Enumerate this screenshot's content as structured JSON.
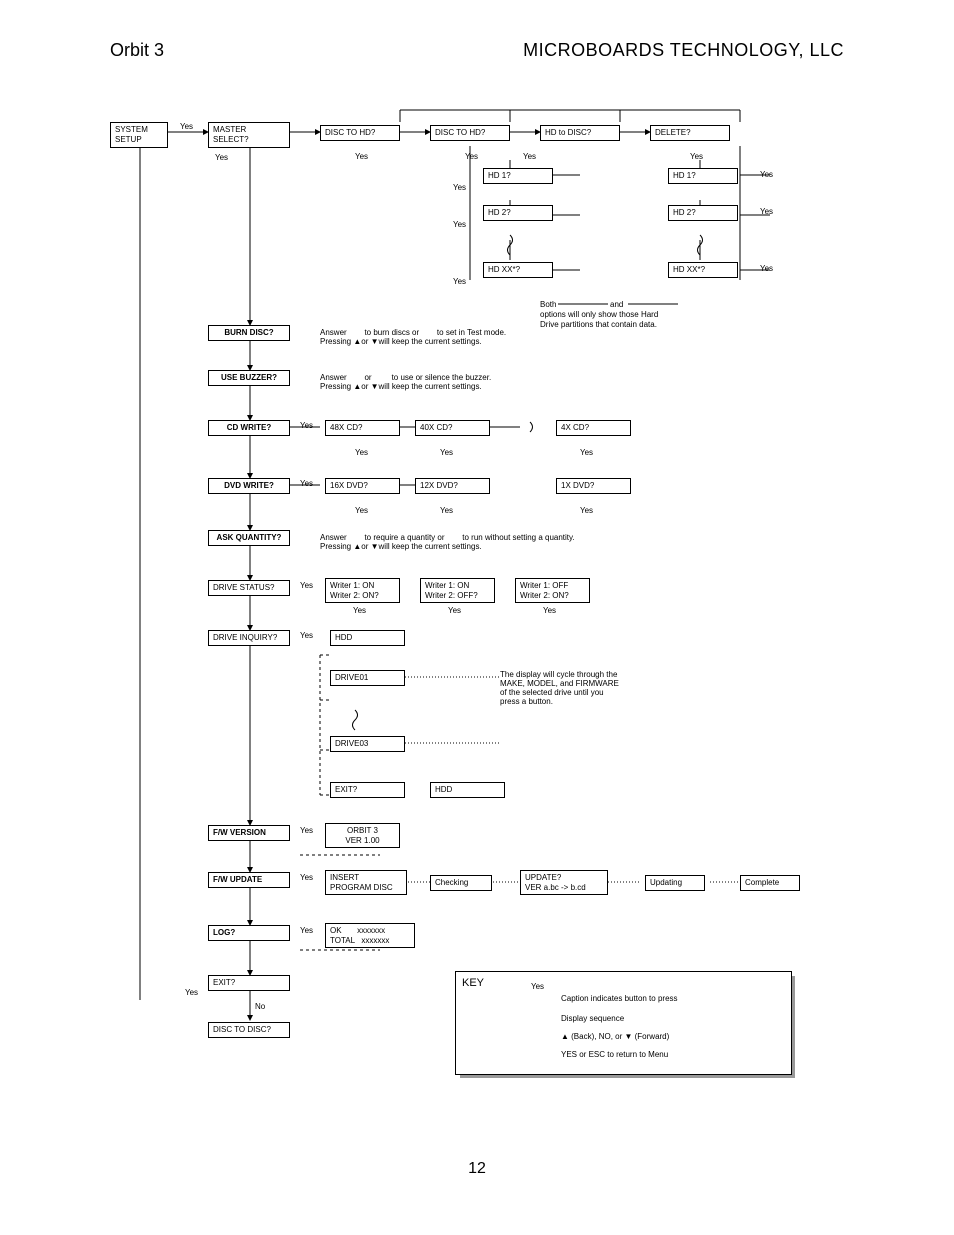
{
  "header": {
    "left": "Orbit 3",
    "right": "MICROBOARDS TECHNOLOGY, LLC",
    "page_number": "12"
  },
  "yes": "Yes",
  "no": "No",
  "col_system_setup": "SYSTEM\nSETUP",
  "col_master_select": "MASTER\nSELECT?",
  "top_row": {
    "a": "DISC TO HD?",
    "b": "DISC TO HD?",
    "c": "HD to DISC?",
    "d": "DELETE?"
  },
  "hd_col": {
    "hd1": "HD 1?",
    "hd2": "HD 2?",
    "hdxx": "HD XX*?"
  },
  "hd_note": {
    "line1": "Both",
    "and": "and",
    "line2": "options will only show those Hard",
    "line3": "Drive partitions that contain data."
  },
  "burn_disc": {
    "label": "BURN DISC?",
    "text": "Answer        to burn discs or        to set in Test mode.\nPressing ▲or ▼will keep the current settings."
  },
  "use_buzzer": {
    "label": "USE BUZZER?",
    "text": "Answer        or         to use or silence the buzzer.\nPressing ▲or ▼will keep the current settings."
  },
  "cd_write": {
    "label": "CD WRITE?",
    "a": "48X CD?",
    "b": "40X CD?",
    "c": "4X CD?"
  },
  "dvd_write": {
    "label": "DVD WRITE?",
    "a": "16X DVD?",
    "b": "12X DVD?",
    "c": "1X DVD?"
  },
  "ask_quantity": {
    "label": "ASK QUANTITY?",
    "text": "Answer        to require a quantity or        to run without setting a quantity.\nPressing ▲or ▼will keep the current settings."
  },
  "drive_status": {
    "label": "DRIVE STATUS?",
    "a": "Writer 1: ON\nWriter 2: ON?",
    "b": "Writer 1: ON\nWriter 2: OFF?",
    "c": "Writer 1: OFF\nWriter 2: ON?"
  },
  "drive_inquiry": {
    "label": "DRIVE INQUIRY?",
    "hdd": "HDD",
    "d01": "DRIVE01",
    "d03": "DRIVE03",
    "exit": "EXIT?",
    "hdd2": "HDD",
    "note": "The display will cycle through the\nMAKE, MODEL, and FIRMWARE\nof the selected drive until you\npress a button."
  },
  "fw_version": {
    "label": "F/W VERSION",
    "val": "ORBIT 3\nVER 1.00"
  },
  "fw_update": {
    "label": "F/W UPDATE",
    "a": "INSERT\nPROGRAM DISC",
    "b": "Checking",
    "c": "UPDATE?\nVER a.bc -> b.cd",
    "d": "Updating",
    "e": "Complete"
  },
  "log": {
    "label": "LOG?",
    "val": "OK       xxxxxxx\nTOTAL   xxxxxxx"
  },
  "exit": {
    "label": "EXIT?",
    "disc_to_disc": "DISC TO DISC?"
  },
  "key": {
    "title": "KEY",
    "caption": "Caption indicates button to press",
    "display_seq": "Display sequence",
    "back_fwd": "▲ (Back),  NO, or ▼ (Forward)",
    "yes_esc": "YES or ESC to return to Menu",
    "yes": "Yes"
  }
}
